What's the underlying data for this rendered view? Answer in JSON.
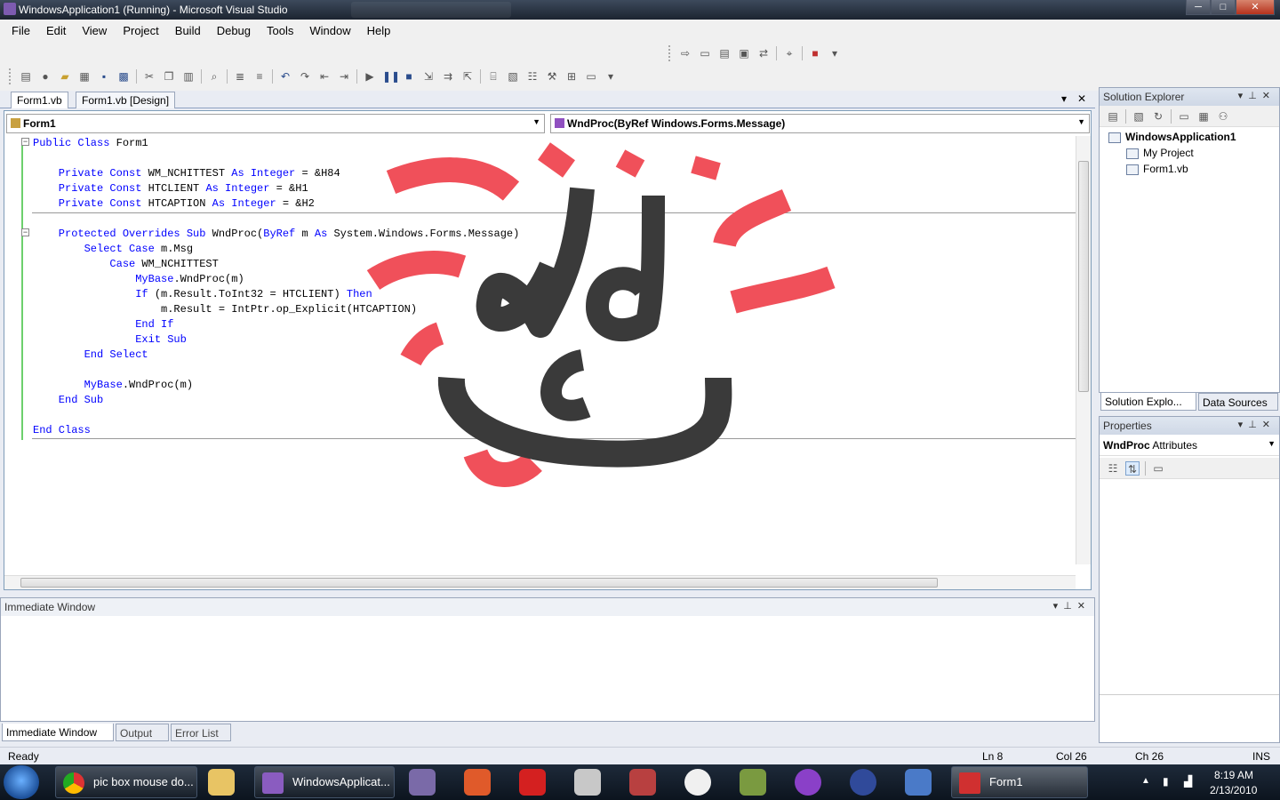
{
  "window": {
    "title": "WindowsApplication1 (Running) - Microsoft Visual Studio",
    "buttons": {
      "min": "─",
      "max": "□",
      "close": "✕"
    }
  },
  "menu": [
    "File",
    "Edit",
    "View",
    "Project",
    "Build",
    "Debug",
    "Tools",
    "Window",
    "Help"
  ],
  "doc_tabs": [
    {
      "label": "Form1.vb",
      "active": true
    },
    {
      "label": "Form1.vb [Design]",
      "active": false
    }
  ],
  "editor": {
    "class_combo": "Form1",
    "method_combo": "WndProc(ByRef Windows.Forms.Message)",
    "code": [
      {
        "kw": "Public Class",
        "rest": " Form1"
      },
      {
        "kw": "",
        "rest": ""
      },
      {
        "kw": "    Private Const",
        "rest": " WM_NCHITTEST ",
        "kw2": "As Integer",
        "tail": " = &H84"
      },
      {
        "kw": "    Private Const",
        "rest": " HTCLIENT ",
        "kw2": "As Integer",
        "tail": " = &H1"
      },
      {
        "kw": "    Private Const",
        "rest": " HTCAPTION ",
        "kw2": "As Integer",
        "tail": " = &H2"
      },
      {
        "kw": "",
        "rest": ""
      },
      {
        "kw": "    Protected Overrides Sub",
        "rest": " WndProc(",
        "kw2": "ByRef",
        "tail": " m ",
        "kw3": "As",
        "tail2": " System.Windows.Forms.Message)"
      },
      {
        "kw": "        Select Case",
        "rest": " m.Msg"
      },
      {
        "kw": "            Case",
        "rest": " WM_NCHITTEST"
      },
      {
        "kw": "                MyBase",
        "rest": ".WndProc(m)"
      },
      {
        "kw": "                If",
        "rest": " (m.Result.ToInt32 = HTCLIENT) ",
        "kw2": "Then"
      },
      {
        "kw": "",
        "rest": "                    m.Result = IntPtr.op_Explicit(HTCAPTION)"
      },
      {
        "kw": "                End If",
        "rest": ""
      },
      {
        "kw": "                Exit Sub",
        "rest": ""
      },
      {
        "kw": "        End Select",
        "rest": ""
      },
      {
        "kw": "",
        "rest": ""
      },
      {
        "kw": "        MyBase",
        "rest": ".WndProc(m)"
      },
      {
        "kw": "    End Sub",
        "rest": ""
      },
      {
        "kw": "",
        "rest": ""
      },
      {
        "kw": "End Class",
        "rest": ""
      }
    ]
  },
  "solution_explorer": {
    "title": "Solution Explorer",
    "tree": [
      "WindowsApplication1",
      "My Project",
      "Form1.vb"
    ],
    "tabs": [
      "Solution Explo...",
      "Data Sources"
    ]
  },
  "properties": {
    "title": "Properties",
    "object": "WndProc",
    "object_type": "Attributes"
  },
  "immediate": {
    "title": "Immediate Window",
    "tabs": [
      "Immediate Window",
      "Output",
      "Error List"
    ]
  },
  "status": {
    "text": "Ready",
    "ln": "Ln 8",
    "col": "Col 26",
    "ch": "Ch 26",
    "mode": "INS"
  },
  "taskbar": {
    "tasks": [
      "pic box mouse do...",
      "WindowsApplicat...",
      "Form1"
    ],
    "time": "8:19 AM",
    "date": "2/13/2010"
  },
  "colors": {
    "keyword": "#0000ff",
    "drawing_dark": "#3a3a3a",
    "drawing_red": "#f0505a",
    "accent": "#9aa6bb"
  }
}
